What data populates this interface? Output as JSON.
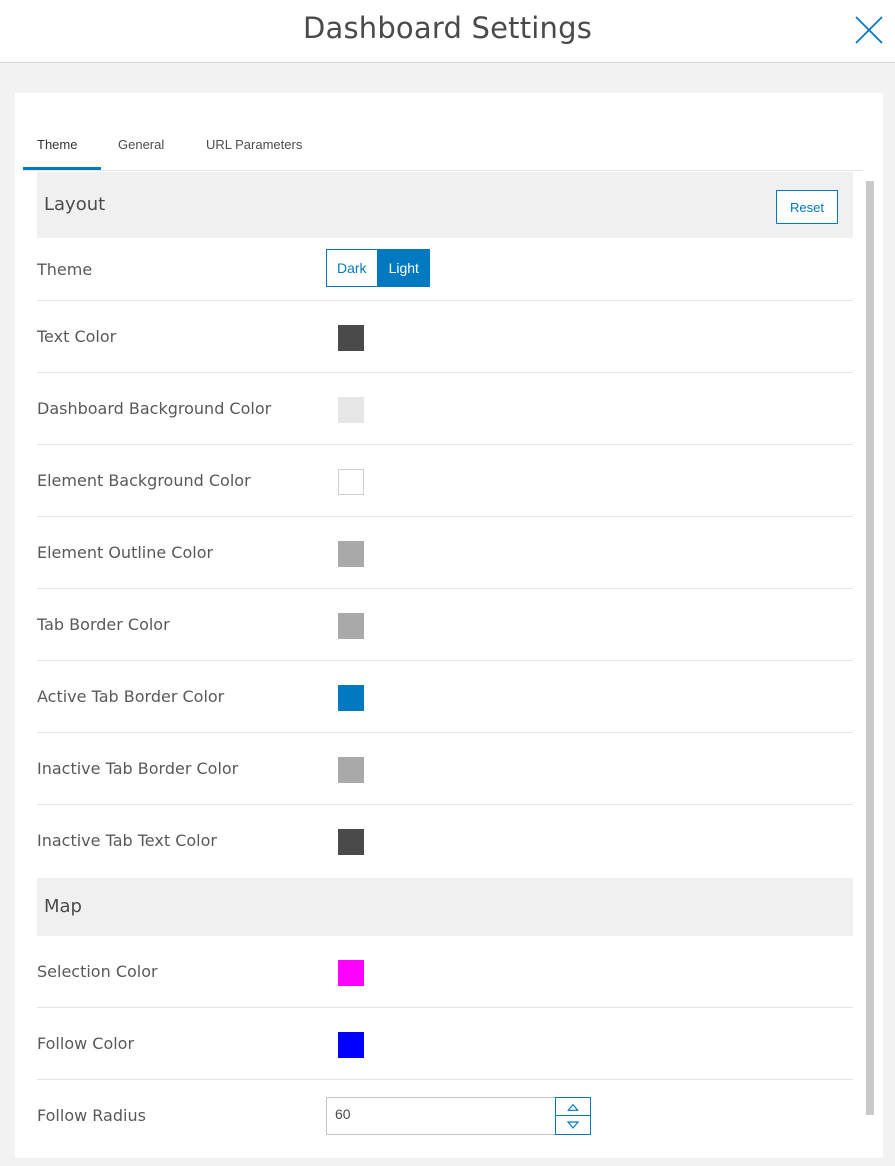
{
  "header": {
    "title": "Dashboard Settings"
  },
  "tabs": [
    {
      "label": "Theme",
      "active": true
    },
    {
      "label": "General",
      "active": false
    },
    {
      "label": "URL Parameters",
      "active": false
    }
  ],
  "layout_section": {
    "title": "Layout",
    "reset_label": "Reset",
    "theme": {
      "label": "Theme",
      "options": [
        "Dark",
        "Light"
      ],
      "selected": "Light"
    },
    "colors": [
      {
        "label": "Text Color",
        "color": "#4a4a4a"
      },
      {
        "label": "Dashboard Background Color",
        "color": "#e6e6e6"
      },
      {
        "label": "Element Background Color",
        "color": "#ffffff"
      },
      {
        "label": "Element Outline Color",
        "color": "#a9a9a9"
      },
      {
        "label": "Tab Border Color",
        "color": "#a9a9a9"
      },
      {
        "label": "Active Tab Border Color",
        "color": "#0079c1"
      },
      {
        "label": "Inactive Tab Border Color",
        "color": "#a9a9a9"
      },
      {
        "label": "Inactive Tab Text Color",
        "color": "#4a4a4a"
      }
    ]
  },
  "map_section": {
    "title": "Map",
    "colors": [
      {
        "label": "Selection Color",
        "color": "#ff00ff"
      },
      {
        "label": "Follow Color",
        "color": "#0000ff"
      }
    ],
    "follow_radius": {
      "label": "Follow Radius",
      "value": "60"
    }
  },
  "icons": {
    "close": "close-icon",
    "up": "chevron-up-icon",
    "down": "chevron-down-icon"
  },
  "accent_color": "#0079c1"
}
